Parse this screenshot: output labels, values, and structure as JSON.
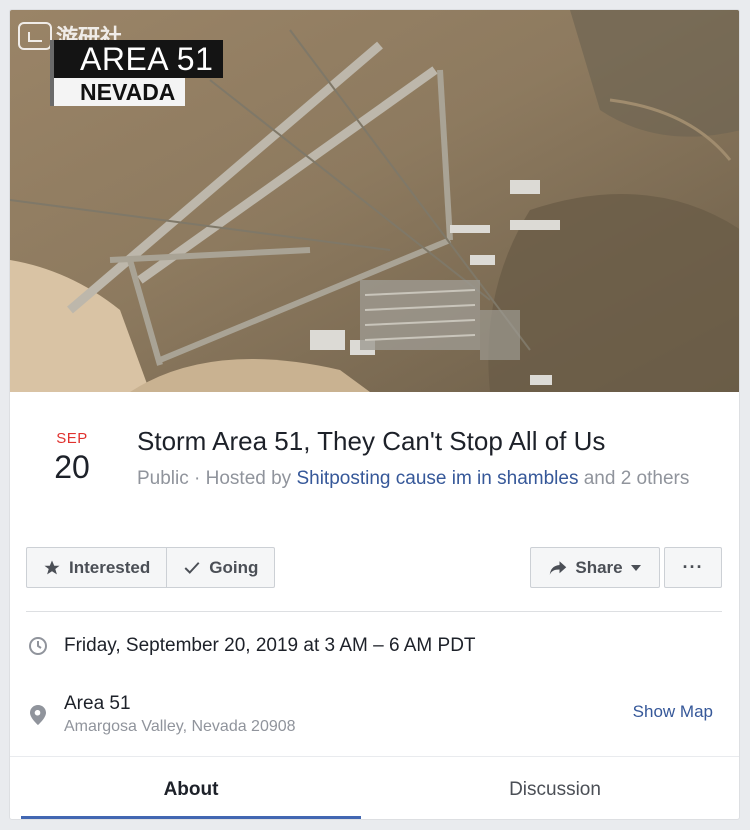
{
  "cover": {
    "caption_line1": "AREA 51",
    "caption_line2": "NEVADA",
    "watermark_text": "游研社",
    "watermark_icon": "gamepad-logo-icon"
  },
  "event": {
    "month": "SEP",
    "day": "20",
    "title": "Storm Area 51, They Can't Stop All of Us",
    "privacy": "Public",
    "separator": " · ",
    "hosted_by_prefix": "Hosted by ",
    "host_name": "Shitposting cause im in shambles",
    "others_text": " and 2 others"
  },
  "actions": {
    "interested_label": "Interested",
    "going_label": "Going",
    "share_label": "Share",
    "more_label": "···"
  },
  "details": {
    "datetime": "Friday, September 20, 2019 at 3 AM – 6 AM PDT",
    "location_name": "Area 51",
    "location_address": "Amargosa Valley, Nevada 20908",
    "show_map_label": "Show Map"
  },
  "tabs": [
    {
      "label": "About",
      "active": true
    },
    {
      "label": "Discussion",
      "active": false
    }
  ],
  "colors": {
    "month_red": "#e0322e",
    "link_blue": "#365899",
    "tab_underline": "#4267b2"
  }
}
